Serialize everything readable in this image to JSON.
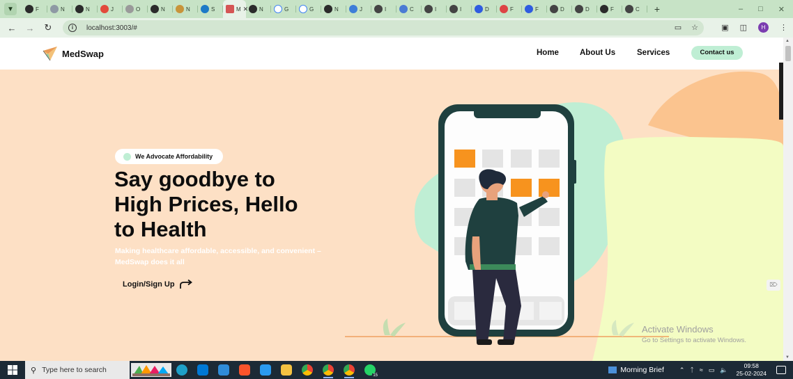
{
  "browser": {
    "tabs": [
      {
        "initial": "F",
        "color": "#2b2b2b"
      },
      {
        "initial": "N",
        "color": "#8e99a4"
      },
      {
        "initial": "N",
        "color": "#2b2b2b"
      },
      {
        "initial": "J",
        "color": "#e24a3b"
      },
      {
        "initial": "O",
        "color": "#9a9a9a"
      },
      {
        "initial": "N",
        "color": "#2b2b2b"
      },
      {
        "initial": "N",
        "color": "#c8943a"
      },
      {
        "initial": "S",
        "color": "#1d7ac7"
      },
      {
        "initial": "M",
        "color": "#d55555",
        "active": true
      },
      {
        "initial": "N",
        "color": "#2b2b2b"
      },
      {
        "initial": "G",
        "color": "#ffffff"
      },
      {
        "initial": "G",
        "color": "#ffffff"
      },
      {
        "initial": "N",
        "color": "#2b2b2b"
      },
      {
        "initial": "J",
        "color": "#3e7ed8"
      },
      {
        "initial": "I",
        "color": "#444444"
      },
      {
        "initial": "C",
        "color": "#4b7bd4"
      },
      {
        "initial": "I",
        "color": "#444444"
      },
      {
        "initial": "I",
        "color": "#444444"
      },
      {
        "initial": "D",
        "color": "#2f5ce0"
      },
      {
        "initial": "F",
        "color": "#d44"
      },
      {
        "initial": "F",
        "color": "#2f5ce0"
      },
      {
        "initial": "D",
        "color": "#444444"
      },
      {
        "initial": "D",
        "color": "#444444"
      },
      {
        "initial": "F",
        "color": "#2b2b2b"
      },
      {
        "initial": "C",
        "color": "#444444"
      }
    ],
    "url": "localhost:3003/#",
    "profile_initial": "H"
  },
  "site": {
    "brand": "MedSwap",
    "nav": {
      "home": "Home",
      "about": "About Us",
      "services": "Services",
      "contact": "Contact us"
    },
    "hero": {
      "badge": "We Advocate Affordability",
      "headline_line1": "Say goodbye to",
      "headline_line2": "High Prices, Hello",
      "headline_line3": "to Health",
      "subtext": "Making healthcare affordable, accessible, and convenient – MedSwap does it all",
      "cta": "Login/Sign Up"
    }
  },
  "watermark": {
    "title": "Activate Windows",
    "subtitle": "Go to Settings to activate Windows."
  },
  "taskbar": {
    "search_placeholder": "Type here to search",
    "weather_label": "Morning Brief",
    "time": "09:58",
    "date": "25-02-2024",
    "whatsapp_badge": "15"
  },
  "colors": {
    "hero_bg": "#fde0c5",
    "accent_mint": "#bfeed4",
    "accent_orange": "#f7931e",
    "phone_frame": "#1f403f",
    "blob_yellow": "#f3fcc3"
  }
}
